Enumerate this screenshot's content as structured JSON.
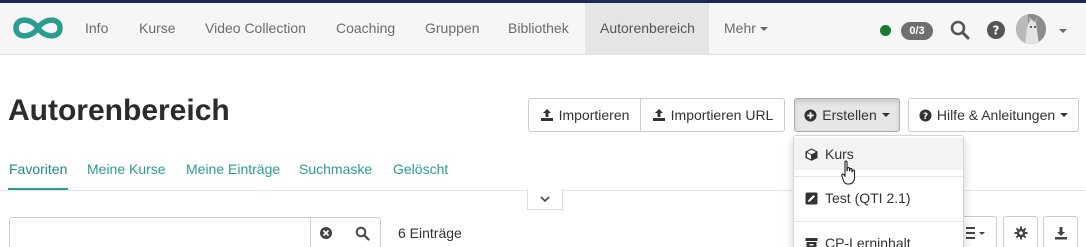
{
  "navbar": {
    "logo": "openolat-infinity-logo",
    "items": [
      {
        "label": "Info"
      },
      {
        "label": "Kurse"
      },
      {
        "label": "Video Collection"
      },
      {
        "label": "Coaching"
      },
      {
        "label": "Gruppen"
      },
      {
        "label": "Bibliothek"
      },
      {
        "label": "Autorenbereich",
        "active": true
      },
      {
        "label": "Mehr",
        "dropdown": true
      }
    ],
    "status_color": "#1a7a2e",
    "counter": "0/3",
    "icons": [
      "search-icon",
      "help-icon",
      "avatar"
    ]
  },
  "page": {
    "title": "Autorenbereich"
  },
  "toolbar": {
    "import_label": "Importieren",
    "import_url_label": "Importieren URL",
    "create_label": "Erstellen",
    "help_label": "Hilfe & Anleitungen"
  },
  "tabs": [
    {
      "label": "Favoriten",
      "active": true
    },
    {
      "label": "Meine Kurse"
    },
    {
      "label": "Meine Einträge"
    },
    {
      "label": "Suchmaske"
    },
    {
      "label": "Gelöscht"
    }
  ],
  "list": {
    "search_value": "",
    "count_text": "6 Einträge"
  },
  "create_menu": {
    "items": [
      {
        "label": "Kurs",
        "icon": "cube-icon"
      },
      {
        "label": "Test (QTI 2.1)",
        "icon": "test-edit-icon"
      },
      {
        "label": "CP-Lerninhalt",
        "icon": "archive-icon"
      }
    ]
  },
  "colors": {
    "accent": "#2a9d8f",
    "topline": "#1d2a52"
  }
}
